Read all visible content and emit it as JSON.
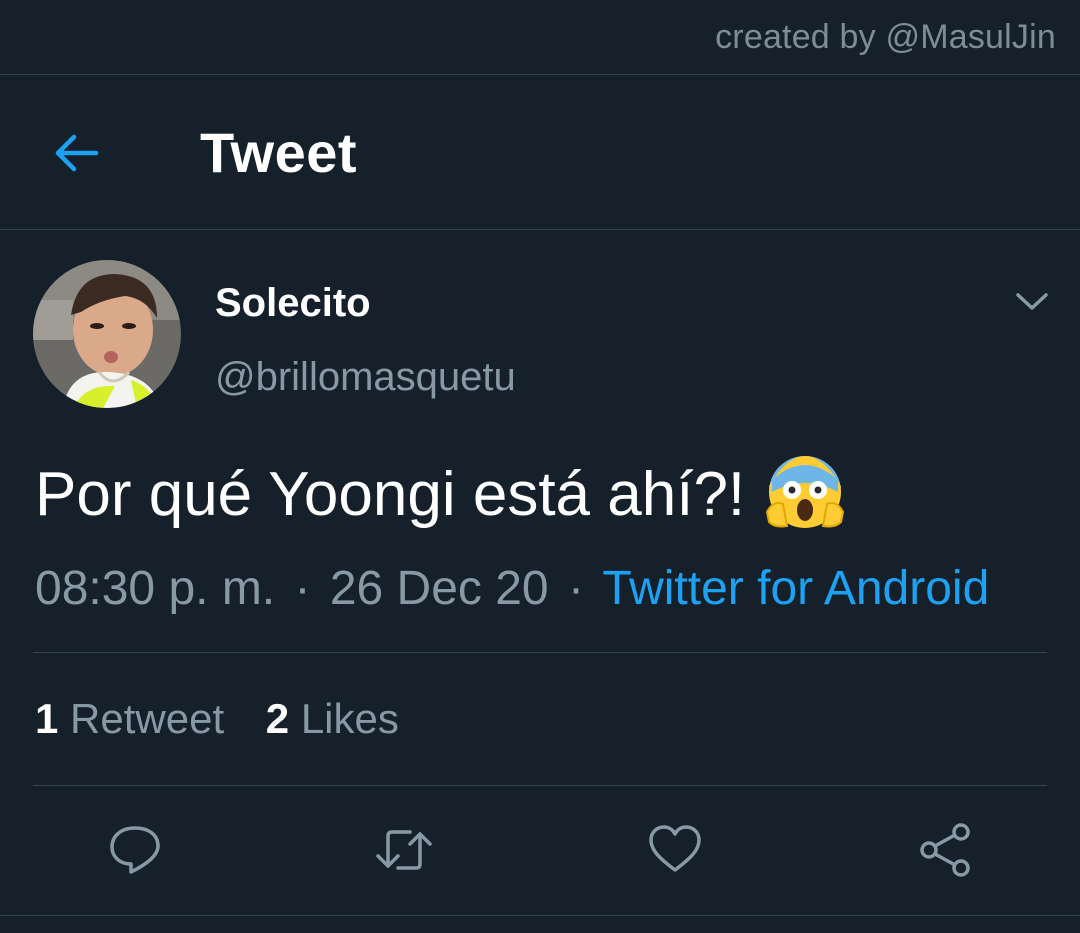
{
  "watermark": "created by @MasulJin",
  "header": {
    "title": "Tweet",
    "back_icon": "arrow-left-icon",
    "accent": "#1da1f2"
  },
  "tweet": {
    "display_name": "Solecito",
    "handle": "@brillomasquetu",
    "text": "Por qué Yoongi está ahí?!",
    "emoji": "face-screaming-in-fear-icon",
    "time": "08:30 p. m.",
    "date": "26 Dec 20",
    "separator": "·",
    "source": "Twitter for Android",
    "menu_icon": "chevron-down-icon"
  },
  "stats": {
    "retweets_count": "1",
    "retweets_label": "Retweet",
    "likes_count": "2",
    "likes_label": "Likes"
  },
  "actions": [
    {
      "name": "reply",
      "icon": "reply-icon"
    },
    {
      "name": "retweet",
      "icon": "retweet-icon"
    },
    {
      "name": "like",
      "icon": "heart-icon"
    },
    {
      "name": "share",
      "icon": "share-icon"
    }
  ],
  "colors": {
    "background": "#15202b",
    "divider": "#38444d",
    "secondary_text": "#8899a6",
    "link": "#1da1f2"
  }
}
